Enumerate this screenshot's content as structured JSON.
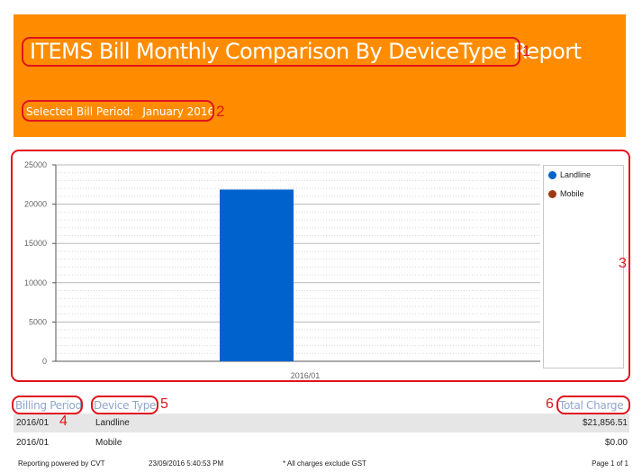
{
  "report": {
    "title": "ITEMS Bill Monthly Comparison By DeviceType Report",
    "bill_period_label": "Selected Bill Period:",
    "bill_period_value": "January 2016"
  },
  "annotations": [
    "1",
    "2",
    "3",
    "4",
    "5",
    "6"
  ],
  "chart_data": {
    "type": "bar",
    "categories": [
      "2016/01"
    ],
    "series": [
      {
        "name": "Landline",
        "values": [
          21856.51
        ],
        "color": "#0062cc"
      },
      {
        "name": "Mobile",
        "values": [
          0
        ],
        "color": "#9e3a12"
      }
    ],
    "ylim": [
      0,
      25000
    ],
    "yticks": [
      "25000",
      "20000",
      "15000",
      "10000",
      "5000",
      "0"
    ],
    "grid": true,
    "legend": "right"
  },
  "table": {
    "headers": {
      "billing_period": "Billing Period",
      "device_type": "Device Type",
      "total_charge": "Total Charge"
    },
    "rows": [
      {
        "period": "2016/01",
        "device": "Landline",
        "charge": "$21,856.51"
      },
      {
        "period": "2016/01",
        "device": "Mobile",
        "charge": "$0.00"
      }
    ]
  },
  "footer": {
    "powered": "Reporting powered by CVT",
    "timestamp": "23/09/2016 5:40:53 PM",
    "note": "* All charges exclude GST",
    "page": "Page 1 of 1"
  }
}
